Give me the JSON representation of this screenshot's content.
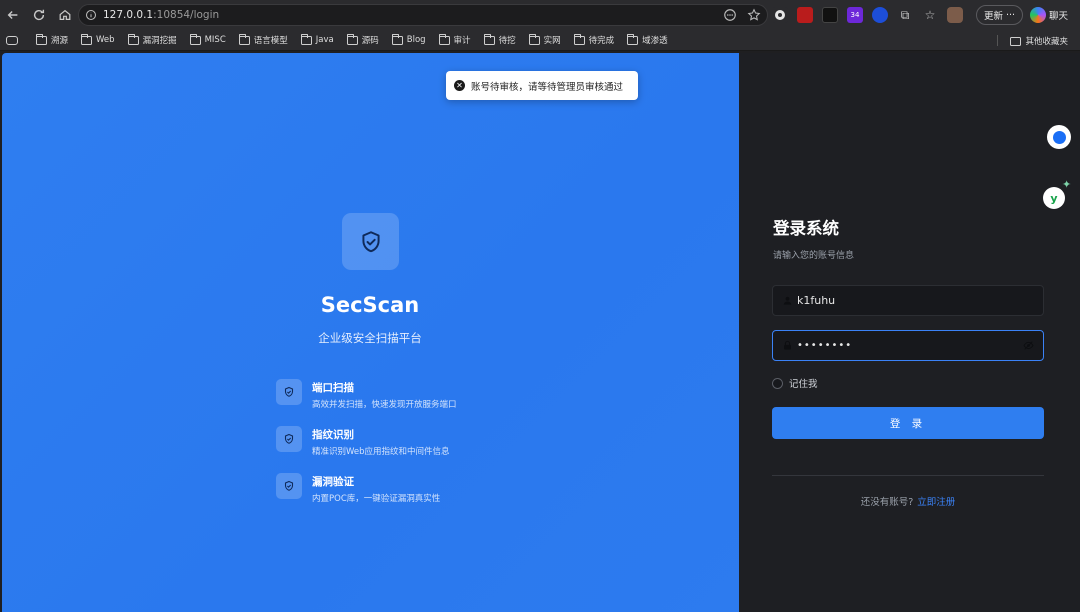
{
  "browser": {
    "url_host": "127.0.0.1",
    "url_rest": ":10854/login",
    "update_label": "更新",
    "chat_label": "聊天",
    "extension_badge": "34"
  },
  "bookmarks": {
    "items": [
      "溯源",
      "Web",
      "漏洞挖掘",
      "MISC",
      "语言模型",
      "Java",
      "源码",
      "Blog",
      "审计",
      "待挖",
      "实网",
      "待完成",
      "域渗透"
    ],
    "other": "其他收藏夹"
  },
  "toast": {
    "message": "账号待审核，请等待管理员审核通过"
  },
  "brand": {
    "title": "SecScan",
    "subtitle": "企业级安全扫描平台"
  },
  "features": [
    {
      "title": "端口扫描",
      "desc": "高效并发扫描，快速发现开放服务端口"
    },
    {
      "title": "指纹识别",
      "desc": "精准识别Web应用指纹和中间件信息"
    },
    {
      "title": "漏洞验证",
      "desc": "内置POC库，一键验证漏洞真实性"
    }
  ],
  "login": {
    "title": "登录系统",
    "subtitle": "请输入您的账号信息",
    "username": "k1fuhu",
    "password_masked": "••••••••",
    "remember_label": "记住我",
    "submit_label": "登 录",
    "register_prompt": "还没有账号?",
    "register_link": "立即注册"
  },
  "colors": {
    "primary": "#2f7ef0",
    "panel_dark": "#1e1f23"
  }
}
